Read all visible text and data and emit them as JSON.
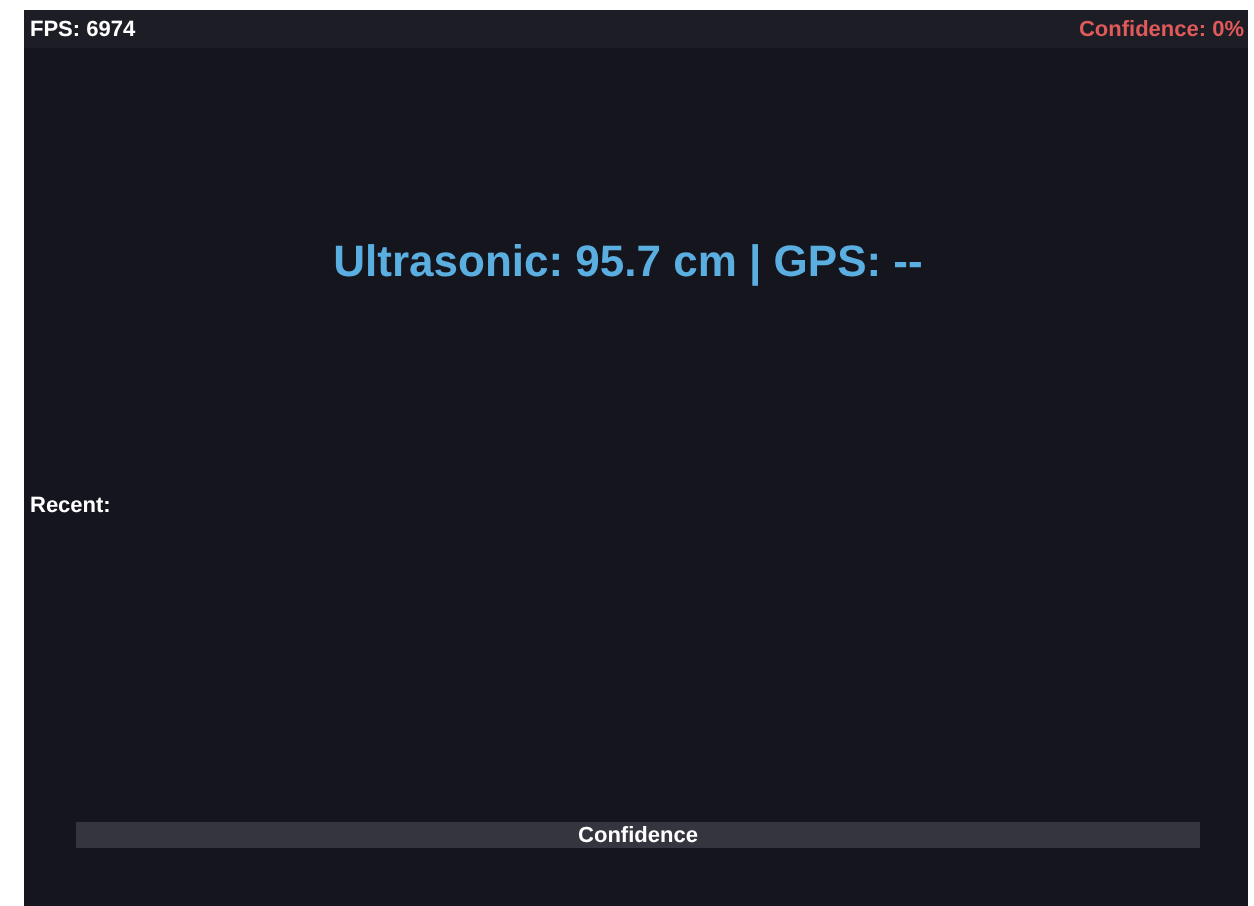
{
  "status_bar": {
    "fps": "FPS: 6974",
    "confidence": "Confidence: 0%"
  },
  "reading": "Ultrasonic: 95.7 cm | GPS: --",
  "recent": {
    "label": "Recent:"
  },
  "confidence_bar": {
    "label": "Confidence",
    "level": 0
  }
}
